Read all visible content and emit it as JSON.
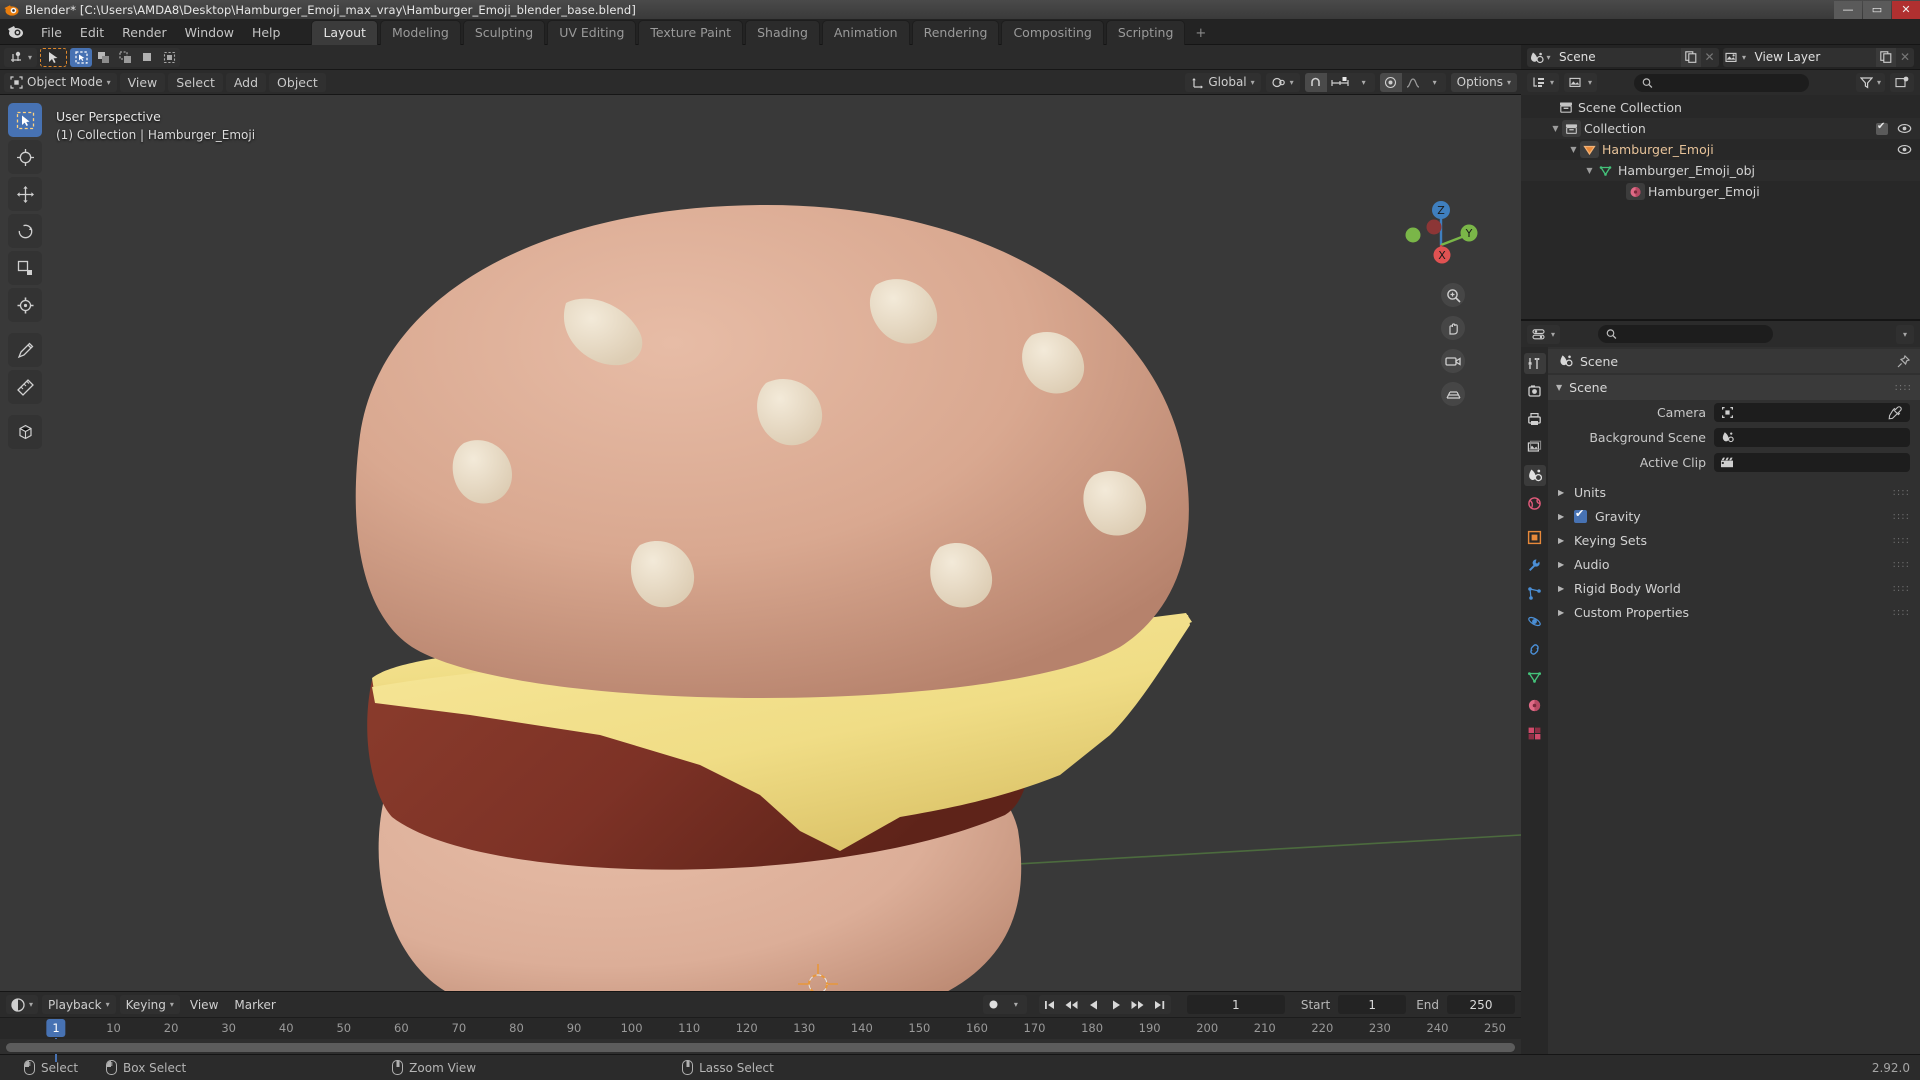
{
  "window": {
    "title": "Blender* [C:\\Users\\AMDA8\\Desktop\\Hamburger_Emoji_max_vray\\Hamburger_Emoji_blender_base.blend]",
    "minimize": "—",
    "maximize": "▭",
    "close": "✕"
  },
  "topbar": {
    "menus": [
      "File",
      "Edit",
      "Render",
      "Window",
      "Help"
    ],
    "workspaces": [
      {
        "label": "Layout",
        "active": true
      },
      {
        "label": "Modeling",
        "active": false
      },
      {
        "label": "Sculpting",
        "active": false
      },
      {
        "label": "UV Editing",
        "active": false
      },
      {
        "label": "Texture Paint",
        "active": false
      },
      {
        "label": "Shading",
        "active": false
      },
      {
        "label": "Animation",
        "active": false
      },
      {
        "label": "Rendering",
        "active": false
      },
      {
        "label": "Compositing",
        "active": false
      },
      {
        "label": "Scripting",
        "active": false
      }
    ],
    "add_workspace": "+"
  },
  "viewport_header": {
    "mode": "Object Mode",
    "menus": [
      "View",
      "Select",
      "Add",
      "Object"
    ],
    "transform_orientation": "Global",
    "options": "Options"
  },
  "viewport": {
    "perspective": "User Perspective",
    "collection_line": "(1) Collection | Hamburger_Emoji",
    "gizmo_axes": {
      "x": "X",
      "y": "Y",
      "z": "Z"
    }
  },
  "timeline": {
    "editor_menus": [
      "Playback",
      "Keying",
      "View",
      "Marker"
    ],
    "current_frame": "1",
    "start_label": "Start",
    "start_value": "1",
    "end_label": "End",
    "end_value": "250",
    "ticks": [
      "1",
      "10",
      "20",
      "30",
      "40",
      "50",
      "60",
      "70",
      "80",
      "90",
      "100",
      "110",
      "120",
      "130",
      "140",
      "150",
      "160",
      "170",
      "180",
      "190",
      "200",
      "210",
      "220",
      "230",
      "240",
      "250"
    ]
  },
  "statusbar": {
    "items": [
      {
        "mouse": "left",
        "label": "Select"
      },
      {
        "mouse": "left-drag",
        "label": "Box Select"
      },
      {
        "mouse": "middle",
        "label": "Zoom View"
      },
      {
        "mouse": "middle-drag",
        "label": "Lasso Select"
      }
    ],
    "version": "2.92.0"
  },
  "scene_strip": {
    "scene_name": "Scene",
    "view_layer_name": "View Layer"
  },
  "outliner": {
    "search_placeholder": "",
    "rows": [
      {
        "indent": 0,
        "tri": "",
        "icon": "collection-icon",
        "label": "Scene Collection",
        "checkbox": false,
        "eye": false
      },
      {
        "indent": 1,
        "tri": "▼",
        "icon": "collection-icon",
        "label": "Collection",
        "checkbox": true,
        "eye": true
      },
      {
        "indent": 2,
        "tri": "▼",
        "icon": "object-mesh-icon",
        "label": "Hamburger_Emoji",
        "checkbox": false,
        "eye": true
      },
      {
        "indent": 3,
        "tri": "▼",
        "icon": "mesh-data-icon",
        "label": "Hamburger_Emoji_obj",
        "checkbox": false,
        "eye": false
      },
      {
        "indent": 4,
        "tri": "",
        "icon": "material-icon",
        "label": "Hamburger_Emoji",
        "checkbox": false,
        "eye": false
      }
    ]
  },
  "properties": {
    "search_placeholder": "",
    "breadcrumb": "Scene",
    "panel_title": "Scene",
    "fields": [
      {
        "label": "Camera",
        "value": "",
        "icon": "camera-icon",
        "eyedropper": true
      },
      {
        "label": "Background Scene",
        "value": "",
        "icon": "scene-icon",
        "eyedropper": false
      },
      {
        "label": "Active Clip",
        "value": "",
        "icon": "clip-icon",
        "eyedropper": false
      }
    ],
    "subpanels": [
      {
        "label": "Units",
        "checkbox": false
      },
      {
        "label": "Gravity",
        "checkbox": true
      },
      {
        "label": "Keying Sets",
        "checkbox": false
      },
      {
        "label": "Audio",
        "checkbox": false
      },
      {
        "label": "Rigid Body World",
        "checkbox": false
      },
      {
        "label": "Custom Properties",
        "checkbox": false
      }
    ],
    "tabs": [
      "tool-icon",
      "render-icon",
      "output-icon",
      "viewlayer-icon",
      "scene-icon",
      "world-icon",
      "object-icon",
      "modifier-icon",
      "particles-icon",
      "physics-icon",
      "constraint-icon",
      "data-icon",
      "material-icon",
      "texture-icon"
    ]
  },
  "colors": {
    "accent_blue": "#4772b3",
    "viewport_bg": "#393939",
    "bun_top": "#d6a68f",
    "bun_bottom": "#e0b39d",
    "patty": "#8c3a2c",
    "cheese": "#f2e08a",
    "seed": "#e8ddc9",
    "axis_x": "#c54545",
    "axis_y": "#7ab648",
    "header_bg": "#2b2b2b"
  }
}
